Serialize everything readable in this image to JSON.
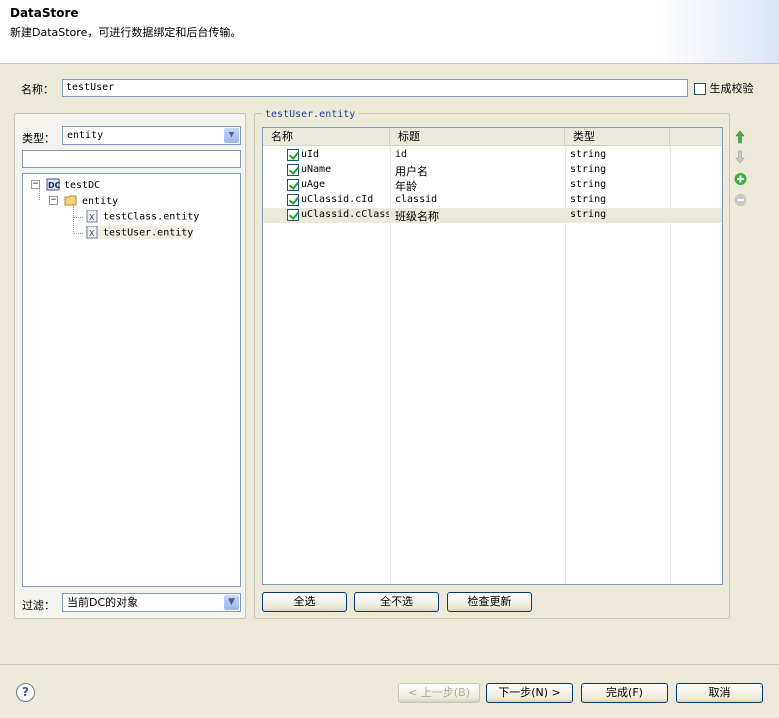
{
  "header": {
    "title": "DataStore",
    "description": "新建DataStore，可进行数据绑定和后台传输。"
  },
  "name_row": {
    "label": "名称：",
    "value": "testUser",
    "checkbox_label": "生成校验"
  },
  "left": {
    "type_label": "类型：",
    "type_value": "entity",
    "search_value": "",
    "tree": [
      {
        "label": "testDC",
        "icon": "dc-icon"
      },
      {
        "label": "entity",
        "icon": "folder-icon"
      },
      {
        "label": "testClass.entity",
        "icon": "entity-file-icon"
      },
      {
        "label": "testUser.entity",
        "icon": "entity-file-icon"
      }
    ],
    "filter_label": "过滤：",
    "filter_value": "当前DC的对象"
  },
  "right": {
    "group_title": "testUser.entity",
    "columns": [
      "名称",
      "标题",
      "类型"
    ],
    "rows": [
      {
        "name": "uId",
        "title": "id",
        "type": "string",
        "checked": true
      },
      {
        "name": "uName",
        "title": "用户名",
        "type": "string",
        "checked": true
      },
      {
        "name": "uAge",
        "title": "年龄",
        "type": "string",
        "checked": true
      },
      {
        "name": "uClassid.cId",
        "title": "classid",
        "type": "string",
        "checked": true
      },
      {
        "name": "uClassid.cClass",
        "title": "班级名称",
        "type": "string",
        "checked": true
      }
    ],
    "buttons": {
      "select_all": "全选",
      "select_none": "全不选",
      "check_update": "检查更新"
    },
    "side_icons": [
      "move-up-icon",
      "move-down-icon",
      "add-icon",
      "remove-icon"
    ]
  },
  "footer": {
    "help": "?",
    "back": "< 上一步(B)",
    "next": "下一步(N) >",
    "finish": "完成(F)",
    "cancel": "取消"
  },
  "colors": {
    "accent_check": "#21a121",
    "group_title": "#1c3f95",
    "add_icon": "#3cae3c"
  }
}
